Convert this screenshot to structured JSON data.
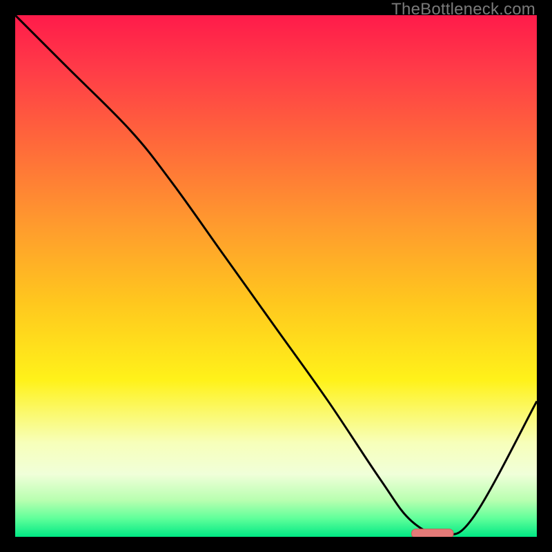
{
  "watermark": "TheBottleneck.com",
  "colors": {
    "frame": "#000000",
    "curve": "#000000",
    "marker_fill": "#e47a78",
    "marker_stroke": "#cf5b59",
    "gradient_stops": [
      {
        "offset": 0.0,
        "color": "#ff1b4a"
      },
      {
        "offset": 0.1,
        "color": "#ff3a48"
      },
      {
        "offset": 0.25,
        "color": "#ff6a3a"
      },
      {
        "offset": 0.4,
        "color": "#ff9a2e"
      },
      {
        "offset": 0.55,
        "color": "#ffc71e"
      },
      {
        "offset": 0.7,
        "color": "#fff21a"
      },
      {
        "offset": 0.82,
        "color": "#f7ffba"
      },
      {
        "offset": 0.88,
        "color": "#f0ffd9"
      },
      {
        "offset": 0.93,
        "color": "#b8ffb0"
      },
      {
        "offset": 0.965,
        "color": "#5fff9a"
      },
      {
        "offset": 1.0,
        "color": "#00e884"
      }
    ]
  },
  "chart_data": {
    "type": "line",
    "title": "",
    "xlabel": "",
    "ylabel": "",
    "xlim": [
      0,
      100
    ],
    "ylim": [
      0,
      100
    ],
    "series": [
      {
        "name": "bottleneck-curve",
        "x": [
          0,
          10,
          22,
          30,
          40,
          50,
          60,
          70,
          76,
          82,
          88,
          100
        ],
        "y": [
          100,
          90,
          78,
          68,
          54,
          40,
          26,
          11,
          3,
          0.5,
          4,
          26
        ]
      }
    ],
    "marker": {
      "name": "optimal-range",
      "x_start": 76,
      "x_end": 84,
      "y": 0.7
    }
  }
}
